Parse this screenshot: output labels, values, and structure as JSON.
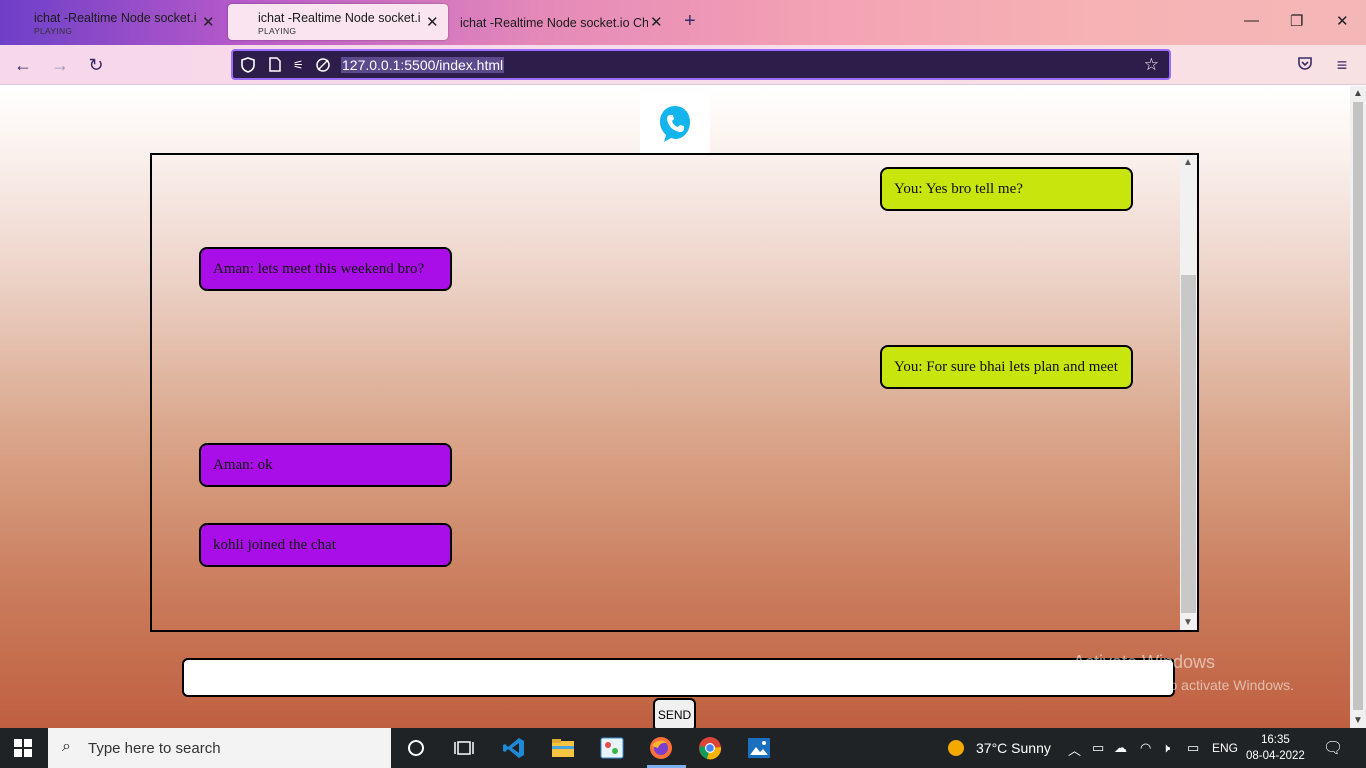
{
  "browser": {
    "tabs": [
      {
        "title": "ichat -Realtime Node socket.io",
        "status": "PLAYING",
        "active": false
      },
      {
        "title": "ichat -Realtime Node socket.io",
        "status": "PLAYING",
        "active": true
      },
      {
        "title": "ichat -Realtime Node socket.io Chat",
        "status": "",
        "active": false
      }
    ],
    "url": "127.0.0.1:5500/index.html"
  },
  "chat": {
    "messages": [
      {
        "text": "You: Yes bro tell me?",
        "side": "right"
      },
      {
        "text": "Aman: lets meet this weekend bro?",
        "side": "left"
      },
      {
        "text": "You: For sure bhai lets plan and meet",
        "side": "right"
      },
      {
        "text": "Aman: ok",
        "side": "left"
      },
      {
        "text": "kohli joined the chat",
        "side": "left"
      }
    ],
    "input_value": "",
    "send_label": "SEND",
    "colors": {
      "right_bubble": "#c8e60e",
      "left_bubble": "#a90ee8"
    }
  },
  "watermark": {
    "line1": "Activate Windows",
    "line2": "Go to Settings to activate Windows."
  },
  "taskbar": {
    "search_placeholder": "Type here to search",
    "weather": "37°C  Sunny",
    "language": "ENG",
    "time": "16:35",
    "date": "08-04-2022"
  }
}
